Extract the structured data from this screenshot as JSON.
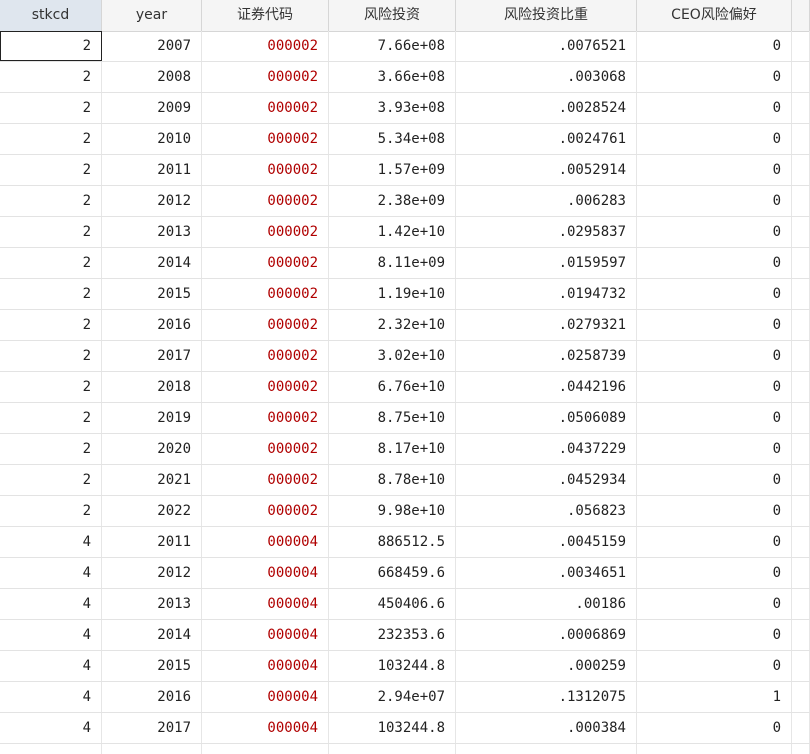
{
  "columns": [
    "stkcd",
    "year",
    "证券代码",
    "风险投资",
    "风险投资比重",
    "CEO风险偏好"
  ],
  "rows": [
    [
      "2",
      "2007",
      "000002",
      "7.66e+08",
      ".0076521",
      "0"
    ],
    [
      "2",
      "2008",
      "000002",
      "3.66e+08",
      ".003068",
      "0"
    ],
    [
      "2",
      "2009",
      "000002",
      "3.93e+08",
      ".0028524",
      "0"
    ],
    [
      "2",
      "2010",
      "000002",
      "5.34e+08",
      ".0024761",
      "0"
    ],
    [
      "2",
      "2011",
      "000002",
      "1.57e+09",
      ".0052914",
      "0"
    ],
    [
      "2",
      "2012",
      "000002",
      "2.38e+09",
      ".006283",
      "0"
    ],
    [
      "2",
      "2013",
      "000002",
      "1.42e+10",
      ".0295837",
      "0"
    ],
    [
      "2",
      "2014",
      "000002",
      "8.11e+09",
      ".0159597",
      "0"
    ],
    [
      "2",
      "2015",
      "000002",
      "1.19e+10",
      ".0194732",
      "0"
    ],
    [
      "2",
      "2016",
      "000002",
      "2.32e+10",
      ".0279321",
      "0"
    ],
    [
      "2",
      "2017",
      "000002",
      "3.02e+10",
      ".0258739",
      "0"
    ],
    [
      "2",
      "2018",
      "000002",
      "6.76e+10",
      ".0442196",
      "0"
    ],
    [
      "2",
      "2019",
      "000002",
      "8.75e+10",
      ".0506089",
      "0"
    ],
    [
      "2",
      "2020",
      "000002",
      "8.17e+10",
      ".0437229",
      "0"
    ],
    [
      "2",
      "2021",
      "000002",
      "8.78e+10",
      ".0452934",
      "0"
    ],
    [
      "2",
      "2022",
      "000002",
      "9.98e+10",
      ".056823",
      "0"
    ],
    [
      "4",
      "2011",
      "000004",
      "886512.5",
      ".0045159",
      "0"
    ],
    [
      "4",
      "2012",
      "000004",
      "668459.6",
      ".0034651",
      "0"
    ],
    [
      "4",
      "2013",
      "000004",
      "450406.6",
      ".00186",
      "0"
    ],
    [
      "4",
      "2014",
      "000004",
      "232353.6",
      ".0006869",
      "0"
    ],
    [
      "4",
      "2015",
      "000004",
      "103244.8",
      ".000259",
      "0"
    ],
    [
      "4",
      "2016",
      "000004",
      "2.94e+07",
      ".1312075",
      "1"
    ],
    [
      "4",
      "2017",
      "000004",
      "103244.8",
      ".000384",
      "0"
    ]
  ],
  "colors": {
    "code_text": "#b00000",
    "header_bg": "#f5f5f5",
    "selected_header_bg": "#dfe6ee"
  }
}
